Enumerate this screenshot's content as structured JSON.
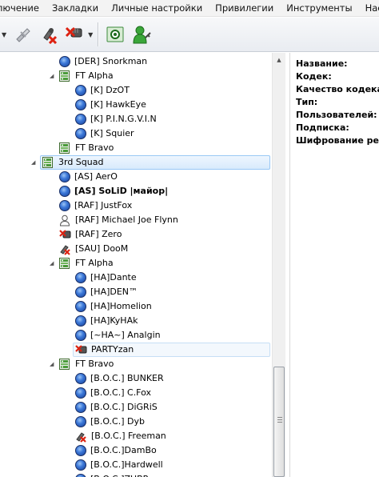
{
  "menu": {
    "items": [
      "лючение",
      "Закладки",
      "Личные настройки",
      "Привилегии",
      "Инструменты",
      "Настрой"
    ]
  },
  "toolbar": {
    "buttons": [
      "connect-icon",
      "disconnect-icon",
      "mute-microphone-icon",
      "mute-speakers-icon",
      "view-icon",
      "add-user-icon"
    ]
  },
  "tree": {
    "rows": [
      {
        "label": "[DER] Snorkman",
        "icon": "user",
        "bold": false
      },
      {
        "label": "FT Alpha",
        "icon": "channel",
        "bold": false
      },
      {
        "label": "[K] DzOT",
        "icon": "user",
        "bold": false
      },
      {
        "label": "[K] HawkEye",
        "icon": "user",
        "bold": false
      },
      {
        "label": "[K] P.I.N.G.V.I.N",
        "icon": "user",
        "bold": false
      },
      {
        "label": "[K] Squier",
        "icon": "user",
        "bold": false
      },
      {
        "label": "FT Bravo",
        "icon": "channel",
        "bold": false
      },
      {
        "label": "3rd Squad",
        "icon": "channel",
        "bold": false
      },
      {
        "label": "[AS] AerO",
        "icon": "user",
        "bold": false
      },
      {
        "label": "[AS] SoLiD |майор|",
        "icon": "user",
        "bold": true
      },
      {
        "label": "[RAF] JustFox",
        "icon": "user",
        "bold": false
      },
      {
        "label": "[RAF] Michael Joe Flynn",
        "icon": "away",
        "bold": false
      },
      {
        "label": "[RAF] Zero",
        "icon": "muted-output",
        "bold": false
      },
      {
        "label": "[SAU] DooM",
        "icon": "muted-input",
        "bold": false
      },
      {
        "label": "FT Alpha",
        "icon": "channel",
        "bold": false
      },
      {
        "label": "[HA]Dante",
        "icon": "user",
        "bold": false
      },
      {
        "label": "[HA]DEN™",
        "icon": "user",
        "bold": false
      },
      {
        "label": "[HA]Homelion",
        "icon": "user",
        "bold": false
      },
      {
        "label": "[HA]KyHAk",
        "icon": "user",
        "bold": false
      },
      {
        "label": "[~HA~] Analgin",
        "icon": "user",
        "bold": false
      },
      {
        "label": "PARTYzan",
        "icon": "muted-output",
        "bold": false
      },
      {
        "label": "FT Bravo",
        "icon": "channel",
        "bold": false
      },
      {
        "label": "[B.O.C.] BUNKER",
        "icon": "user",
        "bold": false
      },
      {
        "label": "[B.O.C.] C.Fox",
        "icon": "user",
        "bold": false
      },
      {
        "label": "[B.O.C.] DiGRiS",
        "icon": "user",
        "bold": false
      },
      {
        "label": "[B.O.C.] Dyb",
        "icon": "user",
        "bold": false
      },
      {
        "label": "[B.O.C.] Freeman",
        "icon": "muted-input",
        "bold": false
      },
      {
        "label": "[B.O.C.]DamBo",
        "icon": "user",
        "bold": false
      },
      {
        "label": "[B.O.C.]Hardwell",
        "icon": "user",
        "bold": false
      },
      {
        "label": "[B.O.C.]ZUBR",
        "icon": "user",
        "bold": false
      }
    ]
  },
  "info": {
    "fields": [
      "Название:",
      "Кодек:",
      "Качество кодека:",
      "Тип:",
      "Пользователей:",
      "Подписка:",
      "Шифрование речи:"
    ]
  },
  "colors": {
    "menubar_bg": "#f3f3f3",
    "selection_border": "#99c8f5",
    "user_icon": "#3c78d8"
  }
}
